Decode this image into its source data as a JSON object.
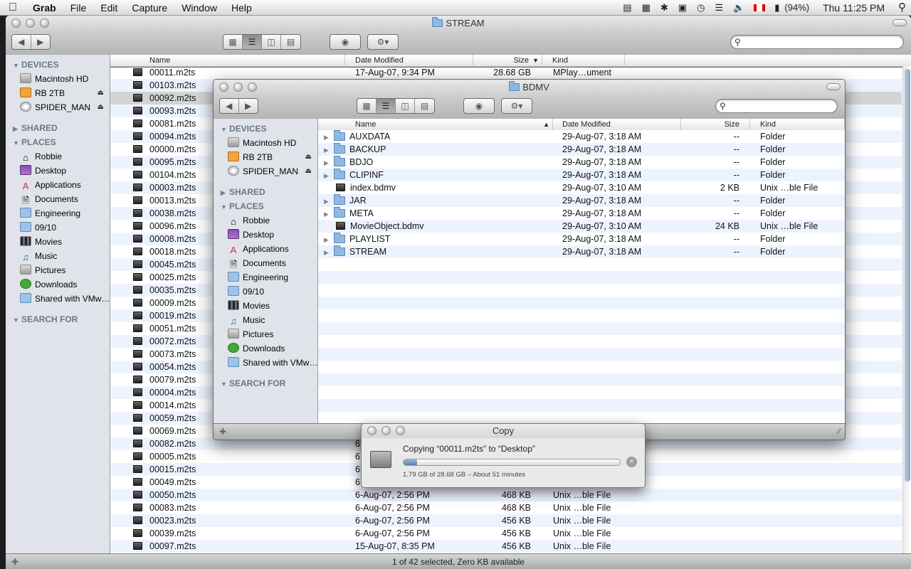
{
  "menubar": {
    "app_name": "Grab",
    "items": [
      "File",
      "Edit",
      "Capture",
      "Window",
      "Help"
    ],
    "battery": "(94%)",
    "clock": "Thu 11:25 PM"
  },
  "stream_window": {
    "title": "STREAM",
    "sidebar": {
      "devices_header": "DEVICES",
      "devices": [
        {
          "label": "Macintosh HD",
          "icon": "hard-drive-icon"
        },
        {
          "label": "RB 2TB",
          "icon": "external-drive-icon"
        },
        {
          "label": "SPIDER_MAN",
          "icon": "disc-icon"
        }
      ],
      "shared_header": "SHARED",
      "places_header": "PLACES",
      "places": [
        {
          "label": "Robbie",
          "icon": "home-icon"
        },
        {
          "label": "Desktop",
          "icon": "desktop-icon"
        },
        {
          "label": "Applications",
          "icon": "applications-icon"
        },
        {
          "label": "Documents",
          "icon": "documents-icon"
        },
        {
          "label": "Engineering",
          "icon": "folder-icon"
        },
        {
          "label": "09/10",
          "icon": "folder-icon"
        },
        {
          "label": "Movies",
          "icon": "movies-icon"
        },
        {
          "label": "Music",
          "icon": "music-icon"
        },
        {
          "label": "Pictures",
          "icon": "pictures-icon"
        },
        {
          "label": "Downloads",
          "icon": "downloads-icon"
        },
        {
          "label": "Shared with VMw…",
          "icon": "folder-icon"
        }
      ],
      "search_header": "SEARCH FOR"
    },
    "columns": {
      "name": "Name",
      "date": "Date Modified",
      "size": "Size",
      "kind": "Kind"
    },
    "rows": [
      {
        "name": "00011.m2ts",
        "date": "17-Aug-07, 9:34 PM",
        "size": "28.68 GB",
        "kind": "MPlay…ument"
      },
      {
        "name": "00103.m2ts",
        "date": "",
        "size": "",
        "kind": ""
      },
      {
        "name": "00092.m2ts",
        "date": "",
        "size": "",
        "kind": ""
      },
      {
        "name": "00093.m2ts",
        "date": "",
        "size": "",
        "kind": ""
      },
      {
        "name": "00081.m2ts",
        "date": "",
        "size": "",
        "kind": ""
      },
      {
        "name": "00094.m2ts",
        "date": "",
        "size": "",
        "kind": ""
      },
      {
        "name": "00000.m2ts",
        "date": "",
        "size": "",
        "kind": ""
      },
      {
        "name": "00095.m2ts",
        "date": "",
        "size": "",
        "kind": ""
      },
      {
        "name": "00104.m2ts",
        "date": "",
        "size": "",
        "kind": ""
      },
      {
        "name": "00003.m2ts",
        "date": "",
        "size": "",
        "kind": ""
      },
      {
        "name": "00013.m2ts",
        "date": "",
        "size": "",
        "kind": ""
      },
      {
        "name": "00038.m2ts",
        "date": "",
        "size": "",
        "kind": ""
      },
      {
        "name": "00096.m2ts",
        "date": "",
        "size": "",
        "kind": ""
      },
      {
        "name": "00008.m2ts",
        "date": "",
        "size": "",
        "kind": ""
      },
      {
        "name": "00018.m2ts",
        "date": "",
        "size": "",
        "kind": ""
      },
      {
        "name": "00045.m2ts",
        "date": "",
        "size": "",
        "kind": ""
      },
      {
        "name": "00025.m2ts",
        "date": "",
        "size": "",
        "kind": ""
      },
      {
        "name": "00035.m2ts",
        "date": "",
        "size": "",
        "kind": ""
      },
      {
        "name": "00009.m2ts",
        "date": "",
        "size": "",
        "kind": ""
      },
      {
        "name": "00019.m2ts",
        "date": "",
        "size": "",
        "kind": ""
      },
      {
        "name": "00051.m2ts",
        "date": "",
        "size": "",
        "kind": ""
      },
      {
        "name": "00072.m2ts",
        "date": "",
        "size": "",
        "kind": ""
      },
      {
        "name": "00073.m2ts",
        "date": "",
        "size": "",
        "kind": ""
      },
      {
        "name": "00054.m2ts",
        "date": "",
        "size": "",
        "kind": ""
      },
      {
        "name": "00079.m2ts",
        "date": "",
        "size": "",
        "kind": ""
      },
      {
        "name": "00004.m2ts",
        "date": "",
        "size": "",
        "kind": ""
      },
      {
        "name": "00014.m2ts",
        "date": "",
        "size": "",
        "kind": ""
      },
      {
        "name": "00059.m2ts",
        "date": "",
        "size": "",
        "kind": ""
      },
      {
        "name": "00069.m2ts",
        "date": "",
        "size": "",
        "kind": ""
      },
      {
        "name": "00082.m2ts",
        "date": "6",
        "size": "",
        "kind": ""
      },
      {
        "name": "00005.m2ts",
        "date": "6",
        "size": "",
        "kind": ""
      },
      {
        "name": "00015.m2ts",
        "date": "6",
        "size": "",
        "kind": ""
      },
      {
        "name": "00049.m2ts",
        "date": "6",
        "size": "",
        "kind": ""
      },
      {
        "name": "00050.m2ts",
        "date": "6-Aug-07, 2:56 PM",
        "size": "468 KB",
        "kind": "Unix …ble File"
      },
      {
        "name": "00083.m2ts",
        "date": "6-Aug-07, 2:56 PM",
        "size": "468 KB",
        "kind": "Unix …ble File"
      },
      {
        "name": "00023.m2ts",
        "date": "6-Aug-07, 2:56 PM",
        "size": "456 KB",
        "kind": "Unix …ble File"
      },
      {
        "name": "00039.m2ts",
        "date": "6-Aug-07, 2:56 PM",
        "size": "456 KB",
        "kind": "Unix …ble File"
      },
      {
        "name": "00097.m2ts",
        "date": "15-Aug-07, 8:35 PM",
        "size": "456 KB",
        "kind": "Unix …ble File"
      }
    ],
    "status": "1 of 42 selected, Zero KB available"
  },
  "bdmv_window": {
    "title": "BDMV",
    "columns": {
      "name": "Name",
      "date": "Date Modified",
      "size": "Size",
      "kind": "Kind"
    },
    "rows": [
      {
        "name": "AUXDATA",
        "date": "29-Aug-07, 3:18 AM",
        "size": "--",
        "kind": "Folder",
        "type": "folder"
      },
      {
        "name": "BACKUP",
        "date": "29-Aug-07, 3:18 AM",
        "size": "--",
        "kind": "Folder",
        "type": "folder"
      },
      {
        "name": "BDJO",
        "date": "29-Aug-07, 3:18 AM",
        "size": "--",
        "kind": "Folder",
        "type": "folder"
      },
      {
        "name": "CLIPINF",
        "date": "29-Aug-07, 3:18 AM",
        "size": "--",
        "kind": "Folder",
        "type": "folder"
      },
      {
        "name": "index.bdmv",
        "date": "29-Aug-07, 3:10 AM",
        "size": "2 KB",
        "kind": "Unix …ble File",
        "type": "file"
      },
      {
        "name": "JAR",
        "date": "29-Aug-07, 3:18 AM",
        "size": "--",
        "kind": "Folder",
        "type": "folder"
      },
      {
        "name": "META",
        "date": "29-Aug-07, 3:18 AM",
        "size": "--",
        "kind": "Folder",
        "type": "folder"
      },
      {
        "name": "MovieObject.bdmv",
        "date": "29-Aug-07, 3:10 AM",
        "size": "24 KB",
        "kind": "Unix …ble File",
        "type": "file"
      },
      {
        "name": "PLAYLIST",
        "date": "29-Aug-07, 3:18 AM",
        "size": "--",
        "kind": "Folder",
        "type": "folder"
      },
      {
        "name": "STREAM",
        "date": "29-Aug-07, 3:18 AM",
        "size": "--",
        "kind": "Folder",
        "type": "folder"
      }
    ]
  },
  "copy_window": {
    "title": "Copy",
    "message": "Copying “00011.m2ts” to “Desktop”",
    "detail": "1.79 GB of 28.68 GB – About 51 minutes",
    "progress": 0.062
  }
}
